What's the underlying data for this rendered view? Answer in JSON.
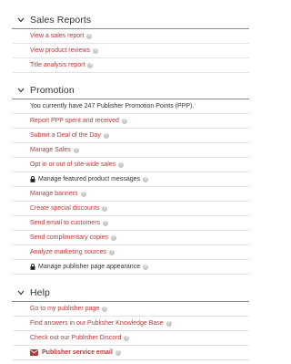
{
  "sales_reports": {
    "title": "Sales Reports",
    "items": [
      {
        "label": "View a sales report"
      },
      {
        "label": "View product reviews"
      },
      {
        "label": "Title analysis report"
      }
    ]
  },
  "promotion": {
    "title": "Promotion",
    "info": "You currently have 247 Publisher Promotion Points (PPP).",
    "items": [
      {
        "label": "Report PPP spent and received"
      },
      {
        "label": "Submit a Deal of the Day"
      },
      {
        "label": "Manage Sales"
      },
      {
        "label": "Opt in or out of site-wide sales"
      },
      {
        "label": "Manage featured product messages",
        "locked": true
      },
      {
        "label": "Manage banners"
      },
      {
        "label": "Create special discounts"
      },
      {
        "label": "Send email to customers"
      },
      {
        "label": "Send complimentary copies"
      },
      {
        "label": "Analyze marketing sources"
      },
      {
        "label": "Manage publisher page appearance",
        "locked": true
      }
    ]
  },
  "help": {
    "title": "Help",
    "items": [
      {
        "label": "Go to my publisher page"
      },
      {
        "label": "Find answers in our Publisher Knowledge Base"
      },
      {
        "label": "Check out our Publisher Discord"
      },
      {
        "label": "Publisher service email",
        "icon": "envelope-icon"
      }
    ]
  },
  "colors": {
    "link": "#b23a3a",
    "text": "#333333",
    "divider": "#e2e2e2",
    "header_rule": "#8a8a8a",
    "help_badge": "#c9c9c9"
  }
}
